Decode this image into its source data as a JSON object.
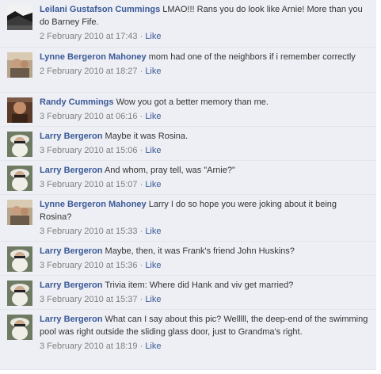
{
  "comments": [
    {
      "author": "Leilani Gustafson Cummings",
      "text": "LMAO!!! Rans you do look like Arnie! More than you do Barney Fife.",
      "timestamp": "2 February 2010 at 17:43",
      "like": "Like",
      "avatar_icon": "landscape-photo"
    },
    {
      "author": "Lynne Bergeron Mahoney",
      "text": "mom had one of the neighbors if i remember correctly",
      "timestamp": "2 February 2010 at 18:27",
      "like": "Like",
      "avatar_icon": "person-photo"
    },
    {
      "author": "Randy Cummings",
      "text": "Wow you got a better memory than me.",
      "timestamp": "3 February 2010 at 06:16",
      "like": "Like",
      "avatar_icon": "person-photo"
    },
    {
      "author": "Larry Bergeron",
      "text": "Maybe it was Rosina.",
      "timestamp": "3 February 2010 at 15:06",
      "like": "Like",
      "avatar_icon": "bearded-man-photo"
    },
    {
      "author": "Larry Bergeron",
      "text": "And whom, pray tell, was \"Arnie?\"",
      "timestamp": "3 February 2010 at 15:07",
      "like": "Like",
      "avatar_icon": "bearded-man-photo"
    },
    {
      "author": "Lynne Bergeron Mahoney",
      "text": "Larry I do so hope you were joking about it being Rosina?",
      "timestamp": "3 February 2010 at 15:33",
      "like": "Like",
      "avatar_icon": "person-photo"
    },
    {
      "author": "Larry Bergeron",
      "text": "Maybe, then, it was Frank's friend John Huskins?",
      "timestamp": "3 February 2010 at 15:36",
      "like": "Like",
      "avatar_icon": "bearded-man-photo"
    },
    {
      "author": "Larry Bergeron",
      "text": "Trivia item: Where did Hank and viv get married?",
      "timestamp": "3 February 2010 at 15:37",
      "like": "Like",
      "avatar_icon": "bearded-man-photo"
    },
    {
      "author": "Larry Bergeron",
      "text": "What can I say about this pic? Welllll, the deep-end of the swimming pool was right outside the sliding glass door, just to Grandma's right.",
      "timestamp": "3 February 2010 at 18:19",
      "like": "Like",
      "avatar_icon": "bearded-man-photo"
    }
  ],
  "colors": {
    "background": "#edeff4",
    "author_link": "#3b5998",
    "timestamp": "#808080",
    "text": "#333333"
  }
}
